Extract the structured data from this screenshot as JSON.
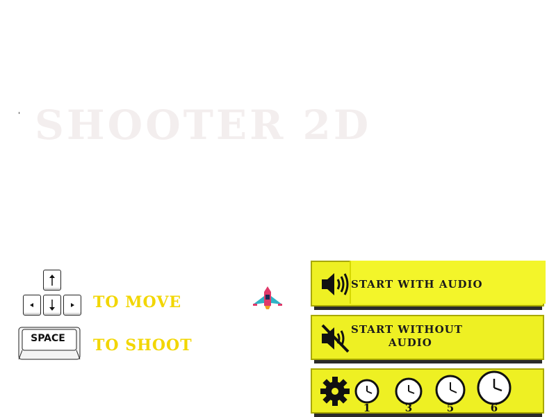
{
  "game": {
    "title": "SHOOTER 2D"
  },
  "controls": {
    "move_label": "TO MOVE",
    "shoot_label": "TO SHOOT",
    "space_key_label": "SPACE"
  },
  "menu": {
    "start_with_audio": "START WITH AUDIO",
    "start_without_audio_line1": "START WITHOUT",
    "start_without_audio_line2": "AUDIO",
    "timers": [
      "1",
      "3",
      "5",
      "6"
    ]
  },
  "colors": {
    "accent_yellow": "#f2d600",
    "panel_yellow": "#eef023",
    "title_faint": "#f3eeee"
  },
  "icons": {
    "audio_on": "speaker-on-icon",
    "audio_off": "speaker-muted-icon",
    "settings": "gear-icon",
    "timer": "clock-icon",
    "player": "spaceship-icon"
  }
}
